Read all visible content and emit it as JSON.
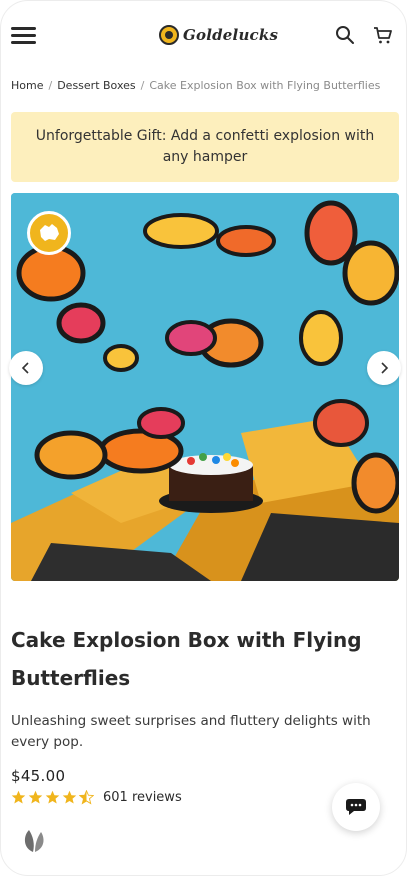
{
  "header": {
    "logo_text": "Goldelucks",
    "icons": [
      "hamburger-menu-icon",
      "search-icon",
      "cart-icon"
    ]
  },
  "breadcrumb": {
    "items": [
      "Home",
      "Dessert Boxes",
      "Cake Explosion Box with Flying Butterflies"
    ],
    "separator": "/"
  },
  "banner": {
    "text": "Unforgettable Gift: Add a confetti explosion with any hamper"
  },
  "gallery": {
    "badge": "australia-map-icon",
    "prev": "chevron-left-icon",
    "next": "chevron-right-icon"
  },
  "product": {
    "title": "Cake Explosion Box with Flying Butterflies",
    "description": "Unleashing sweet surprises and fluttery delights with every pop.",
    "price": "$45.00",
    "rating": 4.5,
    "reviews": "601 reviews"
  },
  "colors": {
    "banner_bg": "#fdefbd",
    "accent_gold": "#f0b51d",
    "star": "#f0b51d",
    "image_bg": "#4eb8d7"
  }
}
